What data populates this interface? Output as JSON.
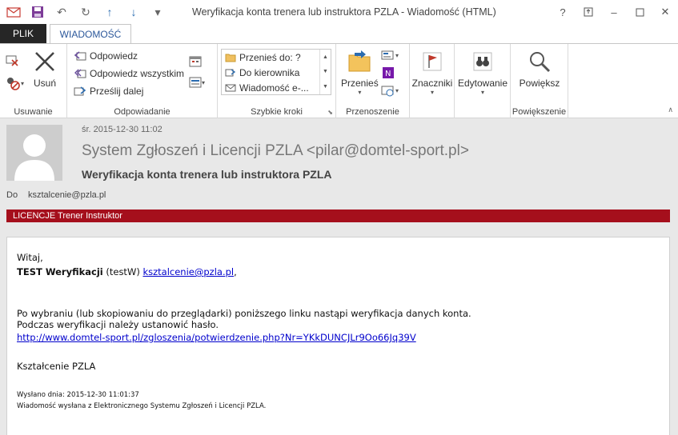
{
  "window": {
    "title": "Weryfikacja konta trenera lub instruktora PZLA - Wiadomość (HTML)",
    "controls": [
      "?",
      "□",
      "–",
      "□",
      "✕"
    ]
  },
  "tabs": {
    "file": "PLIK",
    "message": "WIADOMOŚĆ"
  },
  "ribbon": {
    "groups": {
      "delete": {
        "label": "Usuwanie",
        "delete_button": "Usuń"
      },
      "respond": {
        "label": "Odpowiadanie",
        "reply": "Odpowiedz",
        "reply_all": "Odpowiedz wszystkim",
        "forward": "Prześlij dalej"
      },
      "quicksteps": {
        "label": "Szybkie kroki",
        "items": [
          "Przenieś do: ?",
          "Do kierownika",
          "Wiadomość e-..."
        ]
      },
      "move": {
        "label": "Przenoszenie",
        "move_button": "Przenieś"
      },
      "tags": {
        "label": "Znaczniki"
      },
      "editing": {
        "label": "Edytowanie"
      },
      "zoom": {
        "label": "Powiększenie",
        "zoom_button": "Powiększ"
      }
    }
  },
  "message": {
    "date": "śr. 2015-12-30 11:02",
    "from": "System Zgłoszeń i Licencji PZLA <pilar@domtel-sport.pl>",
    "subject": "Weryfikacja konta trenera lub instruktora PZLA",
    "to_label": "Do",
    "to": "ksztalcenie@pzla.pl",
    "category": "LICENCJE Trener Instruktor"
  },
  "body": {
    "greeting": "Witaj,",
    "name_bold": "TEST Weryfikacji",
    "name_login": " (testW) ",
    "email": "ksztalcenie@pzla.pl",
    "comma": ",",
    "line1": "Po wybraniu (lub skopiowaniu do przeglądarki) poniższego linku nastąpi weryfikacja danych konta.",
    "line2": "Podczas weryfikacji należy ustanowić hasło.",
    "link": "http://www.domtel-sport.pl/zgloszenia/potwierdzenie.php?Nr=YKkDUNCJLr9Oo66Jq39V",
    "signature": "Kształcenie PZLA",
    "sent": "Wysłano dnia: 2015-12-30 11:01:37",
    "footer": "Wiadomość wysłana z Elektronicznego Systemu Zgłoszeń i Licencji PZLA."
  },
  "colors": {
    "category_bg": "#a50f1c",
    "tab_file_bg": "#262626",
    "accent": "#2b579a",
    "link": "#0000cc"
  }
}
